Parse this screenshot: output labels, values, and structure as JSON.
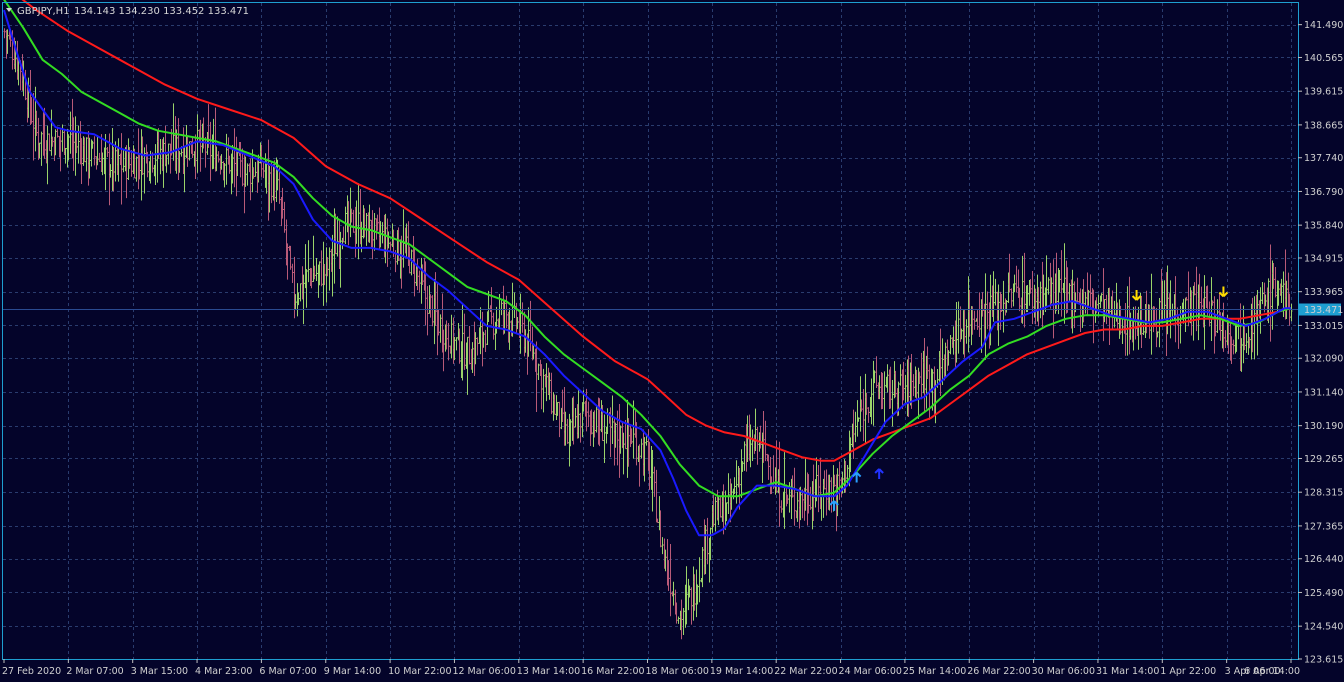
{
  "header": {
    "symbol": "GBPJPY,H1",
    "ohlc": "134.143 134.230 133.452 133.471"
  },
  "current_price_label": "133.471",
  "colors": {
    "background": "#04042a",
    "frame": "#1e9fd0",
    "grid": "#2a3c6e",
    "bull_bar": "#9ad36a",
    "bear_bar": "#b85a78",
    "ma_fast": "#1a1aff",
    "ma_mid": "#33dd22",
    "ma_slow": "#ff1a1a",
    "price_line": "#2a4a90",
    "price_tag": "#1e9fd0",
    "arrow_up_dark": "#2233ff",
    "arrow_up_light": "#2aa0ff",
    "arrow_down": "#ffdd00"
  },
  "chart_data": {
    "type": "line",
    "title": "GBPJPY,H1",
    "ylim": [
      123.615,
      142.1
    ],
    "y_ticks": [
      "141.490",
      "140.565",
      "139.615",
      "138.665",
      "137.740",
      "136.790",
      "135.840",
      "134.915",
      "133.965",
      "133.015",
      "132.090",
      "131.140",
      "130.190",
      "129.265",
      "128.315",
      "127.365",
      "126.440",
      "125.490",
      "124.540",
      "123.615"
    ],
    "x_ticks": [
      "27 Feb 2020",
      "2 Mar 07:00",
      "3 Mar 15:00",
      "4 Mar 23:00",
      "6 Mar 07:00",
      "9 Mar 14:00",
      "10 Mar 22:00",
      "12 Mar 06:00",
      "13 Mar 14:00",
      "16 Mar 22:00",
      "18 Mar 06:00",
      "19 Mar 14:00",
      "22 Mar 22:00",
      "24 Mar 06:00",
      "25 Mar 14:00",
      "26 Mar 22:00",
      "30 Mar 06:00",
      "31 Mar 14:00",
      "1 Apr 22:00",
      "3 Apr 06:00",
      "6 Apr 14:00"
    ],
    "x_index": [
      0,
      20,
      40,
      60,
      80,
      100,
      120,
      140,
      160,
      180,
      200,
      220,
      240,
      260,
      280,
      300,
      320,
      340,
      360,
      380,
      400
    ],
    "current_price": 133.471,
    "price_path": [
      [
        0,
        141.3
      ],
      [
        5,
        140.3
      ],
      [
        10,
        138.4
      ],
      [
        15,
        138.2
      ],
      [
        20,
        138.3
      ],
      [
        25,
        137.9
      ],
      [
        30,
        137.7
      ],
      [
        35,
        137.5
      ],
      [
        40,
        137.6
      ],
      [
        45,
        137.8
      ],
      [
        50,
        137.9
      ],
      [
        55,
        138.0
      ],
      [
        60,
        138.1
      ],
      [
        65,
        137.9
      ],
      [
        70,
        137.6
      ],
      [
        75,
        137.3
      ],
      [
        80,
        137.5
      ],
      [
        85,
        136.8
      ],
      [
        90,
        133.8
      ],
      [
        95,
        134.5
      ],
      [
        100,
        134.5
      ],
      [
        105,
        135.8
      ],
      [
        110,
        135.9
      ],
      [
        115,
        135.6
      ],
      [
        120,
        135.3
      ],
      [
        125,
        135.1
      ],
      [
        130,
        134.0
      ],
      [
        135,
        133.1
      ],
      [
        140,
        132.5
      ],
      [
        145,
        132.2
      ],
      [
        150,
        133.0
      ],
      [
        155,
        133.4
      ],
      [
        160,
        133.0
      ],
      [
        165,
        132.1
      ],
      [
        170,
        130.9
      ],
      [
        175,
        129.8
      ],
      [
        180,
        130.6
      ],
      [
        185,
        130.2
      ],
      [
        190,
        129.9
      ],
      [
        195,
        129.9
      ],
      [
        200,
        129.3
      ],
      [
        205,
        126.5
      ],
      [
        210,
        124.8
      ],
      [
        215,
        125.7
      ],
      [
        220,
        127.6
      ],
      [
        225,
        127.8
      ],
      [
        230,
        129.4
      ],
      [
        235,
        129.8
      ],
      [
        240,
        128.4
      ],
      [
        245,
        128.0
      ],
      [
        250,
        128.3
      ],
      [
        255,
        128.4
      ],
      [
        260,
        128.5
      ],
      [
        265,
        130.3
      ],
      [
        270,
        131.3
      ],
      [
        275,
        131.2
      ],
      [
        280,
        131.3
      ],
      [
        285,
        131.6
      ],
      [
        290,
        131.6
      ],
      [
        295,
        132.6
      ],
      [
        300,
        133.3
      ],
      [
        305,
        133.4
      ],
      [
        310,
        133.7
      ],
      [
        315,
        134.0
      ],
      [
        320,
        133.8
      ],
      [
        325,
        134.0
      ],
      [
        330,
        133.9
      ],
      [
        335,
        133.8
      ],
      [
        340,
        133.6
      ],
      [
        345,
        133.3
      ],
      [
        350,
        133.1
      ],
      [
        355,
        133.1
      ],
      [
        360,
        133.3
      ],
      [
        365,
        133.5
      ],
      [
        370,
        133.6
      ],
      [
        375,
        133.4
      ],
      [
        380,
        132.9
      ],
      [
        385,
        132.8
      ],
      [
        390,
        133.4
      ],
      [
        395,
        134.2
      ],
      [
        400,
        133.5
      ]
    ],
    "series": [
      {
        "name": "",
        "color": "#1a1aff",
        "values": [
          [
            0,
            141.9
          ],
          [
            4,
            140.7
          ],
          [
            8,
            139.6
          ],
          [
            12,
            139.1
          ],
          [
            16,
            138.6
          ],
          [
            20,
            138.5
          ],
          [
            28,
            138.4
          ],
          [
            36,
            138.0
          ],
          [
            44,
            137.8
          ],
          [
            52,
            137.9
          ],
          [
            60,
            138.2
          ],
          [
            68,
            138.1
          ],
          [
            76,
            137.8
          ],
          [
            84,
            137.5
          ],
          [
            90,
            137.0
          ],
          [
            96,
            136.0
          ],
          [
            102,
            135.4
          ],
          [
            108,
            135.2
          ],
          [
            114,
            135.2
          ],
          [
            120,
            135.1
          ],
          [
            126,
            134.9
          ],
          [
            132,
            134.4
          ],
          [
            138,
            134.0
          ],
          [
            144,
            133.5
          ],
          [
            150,
            133.0
          ],
          [
            156,
            132.9
          ],
          [
            162,
            132.7
          ],
          [
            168,
            132.2
          ],
          [
            174,
            131.6
          ],
          [
            180,
            131.1
          ],
          [
            186,
            130.6
          ],
          [
            192,
            130.3
          ],
          [
            198,
            130.1
          ],
          [
            204,
            129.5
          ],
          [
            208,
            128.7
          ],
          [
            212,
            127.8
          ],
          [
            216,
            127.1
          ],
          [
            220,
            127.1
          ],
          [
            224,
            127.3
          ],
          [
            228,
            127.9
          ],
          [
            234,
            128.5
          ],
          [
            240,
            128.5
          ],
          [
            246,
            128.4
          ],
          [
            252,
            128.2
          ],
          [
            258,
            128.2
          ],
          [
            262,
            128.5
          ],
          [
            268,
            129.4
          ],
          [
            274,
            130.3
          ],
          [
            280,
            130.8
          ],
          [
            286,
            131.0
          ],
          [
            292,
            131.5
          ],
          [
            298,
            132.0
          ],
          [
            304,
            132.4
          ],
          [
            308,
            133.1
          ],
          [
            314,
            133.2
          ],
          [
            320,
            133.4
          ],
          [
            326,
            133.6
          ],
          [
            332,
            133.7
          ],
          [
            338,
            133.5
          ],
          [
            344,
            133.3
          ],
          [
            350,
            133.2
          ],
          [
            356,
            133.1
          ],
          [
            362,
            133.2
          ],
          [
            368,
            133.4
          ],
          [
            374,
            133.4
          ],
          [
            380,
            133.2
          ],
          [
            386,
            133.0
          ],
          [
            392,
            133.2
          ],
          [
            398,
            133.5
          ],
          [
            400,
            133.5
          ]
        ]
      },
      {
        "name": "",
        "color": "#33dd22",
        "values": [
          [
            0,
            142.2
          ],
          [
            6,
            141.4
          ],
          [
            12,
            140.5
          ],
          [
            18,
            140.1
          ],
          [
            24,
            139.6
          ],
          [
            30,
            139.3
          ],
          [
            36,
            139.0
          ],
          [
            42,
            138.7
          ],
          [
            48,
            138.5
          ],
          [
            54,
            138.4
          ],
          [
            60,
            138.3
          ],
          [
            66,
            138.2
          ],
          [
            72,
            138.0
          ],
          [
            78,
            137.8
          ],
          [
            84,
            137.6
          ],
          [
            90,
            137.2
          ],
          [
            96,
            136.6
          ],
          [
            102,
            136.1
          ],
          [
            108,
            135.8
          ],
          [
            114,
            135.7
          ],
          [
            120,
            135.5
          ],
          [
            126,
            135.3
          ],
          [
            132,
            134.9
          ],
          [
            138,
            134.5
          ],
          [
            144,
            134.1
          ],
          [
            150,
            133.9
          ],
          [
            156,
            133.7
          ],
          [
            162,
            133.3
          ],
          [
            168,
            132.7
          ],
          [
            174,
            132.2
          ],
          [
            180,
            131.8
          ],
          [
            186,
            131.4
          ],
          [
            192,
            131.0
          ],
          [
            198,
            130.5
          ],
          [
            204,
            129.9
          ],
          [
            210,
            129.1
          ],
          [
            216,
            128.5
          ],
          [
            222,
            128.2
          ],
          [
            228,
            128.2
          ],
          [
            234,
            128.4
          ],
          [
            240,
            128.6
          ],
          [
            246,
            128.4
          ],
          [
            252,
            128.2
          ],
          [
            258,
            128.3
          ],
          [
            264,
            128.8
          ],
          [
            270,
            129.4
          ],
          [
            276,
            129.9
          ],
          [
            282,
            130.3
          ],
          [
            288,
            130.7
          ],
          [
            294,
            131.2
          ],
          [
            300,
            131.6
          ],
          [
            306,
            132.2
          ],
          [
            312,
            132.5
          ],
          [
            318,
            132.7
          ],
          [
            324,
            133.0
          ],
          [
            330,
            133.2
          ],
          [
            336,
            133.3
          ],
          [
            342,
            133.3
          ],
          [
            348,
            133.2
          ],
          [
            354,
            133.1
          ],
          [
            360,
            133.1
          ],
          [
            366,
            133.2
          ],
          [
            372,
            133.3
          ],
          [
            378,
            133.2
          ],
          [
            384,
            133.0
          ],
          [
            390,
            133.1
          ],
          [
            396,
            133.4
          ],
          [
            400,
            133.5
          ]
        ]
      },
      {
        "name": "",
        "color": "#ff1a1a",
        "values": [
          [
            0,
            142.6
          ],
          [
            10,
            141.9
          ],
          [
            20,
            141.3
          ],
          [
            30,
            140.8
          ],
          [
            40,
            140.3
          ],
          [
            50,
            139.8
          ],
          [
            60,
            139.4
          ],
          [
            70,
            139.1
          ],
          [
            80,
            138.8
          ],
          [
            90,
            138.3
          ],
          [
            100,
            137.5
          ],
          [
            110,
            137.0
          ],
          [
            120,
            136.6
          ],
          [
            130,
            136.0
          ],
          [
            140,
            135.4
          ],
          [
            150,
            134.8
          ],
          [
            160,
            134.3
          ],
          [
            170,
            133.5
          ],
          [
            180,
            132.7
          ],
          [
            190,
            132.0
          ],
          [
            200,
            131.5
          ],
          [
            206,
            131.0
          ],
          [
            212,
            130.5
          ],
          [
            218,
            130.2
          ],
          [
            224,
            130.0
          ],
          [
            230,
            129.9
          ],
          [
            236,
            129.7
          ],
          [
            242,
            129.5
          ],
          [
            248,
            129.3
          ],
          [
            254,
            129.2
          ],
          [
            258,
            129.2
          ],
          [
            264,
            129.5
          ],
          [
            270,
            129.8
          ],
          [
            276,
            130.0
          ],
          [
            282,
            130.2
          ],
          [
            288,
            130.4
          ],
          [
            294,
            130.8
          ],
          [
            300,
            131.2
          ],
          [
            306,
            131.6
          ],
          [
            312,
            131.9
          ],
          [
            318,
            132.2
          ],
          [
            324,
            132.4
          ],
          [
            330,
            132.6
          ],
          [
            336,
            132.8
          ],
          [
            342,
            132.9
          ],
          [
            348,
            132.9
          ],
          [
            354,
            133.0
          ],
          [
            360,
            133.0
          ],
          [
            366,
            133.1
          ],
          [
            372,
            133.2
          ],
          [
            378,
            133.2
          ],
          [
            384,
            133.2
          ],
          [
            390,
            133.3
          ],
          [
            396,
            133.4
          ],
          [
            400,
            133.5
          ]
        ]
      }
    ],
    "signals": [
      {
        "type": "up",
        "x": 258,
        "price": 127.9,
        "color": "#2aa0ff"
      },
      {
        "type": "up",
        "x": 265,
        "price": 128.7,
        "color": "#2aa0ff"
      },
      {
        "type": "up",
        "x": 272,
        "price": 128.8,
        "color": "#2233ff"
      },
      {
        "type": "down",
        "x": 352,
        "price": 133.9,
        "color": "#ffdd00"
      },
      {
        "type": "down",
        "x": 379,
        "price": 134.0,
        "color": "#ffdd00"
      }
    ]
  }
}
